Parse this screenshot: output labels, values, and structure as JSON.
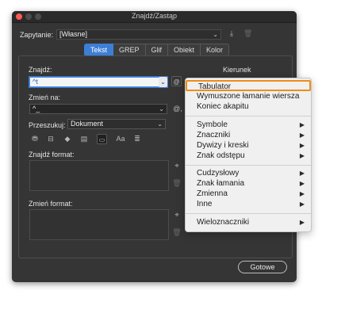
{
  "window": {
    "title": "Znajdź/Zastąp"
  },
  "query": {
    "label": "Zapytanie:",
    "value": "[Własne]"
  },
  "tabs": [
    {
      "label": "Tekst",
      "active": true
    },
    {
      "label": "GREP",
      "active": false
    },
    {
      "label": "Glif",
      "active": false
    },
    {
      "label": "Obiekt",
      "active": false
    },
    {
      "label": "Kolor",
      "active": false
    }
  ],
  "find": {
    "label": "Znajdź:",
    "value": "^t"
  },
  "direction": {
    "label": "Kierunek"
  },
  "replace": {
    "label": "Zmień na:",
    "value": "^_"
  },
  "search": {
    "label": "Przeszukuj:",
    "value": "Dokument"
  },
  "options_icons": [
    "lock-layers-icon",
    "lock-stories-icon",
    "hidden-layers-icon",
    "master-pages-icon",
    "footnotes-icon",
    "case-sensitive-icon",
    "whole-word-icon"
  ],
  "case_label": "Aa",
  "find_format": {
    "label": "Znajdź format:"
  },
  "change_format": {
    "label": "Zmień format:"
  },
  "done_button": "Gotowe",
  "special_menu": {
    "group1": [
      "Tabulator",
      "Wymuszone łamanie wiersza",
      "Koniec akapitu"
    ],
    "group2": [
      "Symbole",
      "Znaczniki",
      "Dywizy i kreski",
      "Znak odstępu"
    ],
    "group3": [
      "Cudzysłowy",
      "Znak łamania",
      "Zmienna",
      "Inne"
    ],
    "group4": [
      "Wieloznaczniki"
    ],
    "highlighted": "Tabulator",
    "accent": "#f08c18"
  },
  "colors": {
    "window_bg": "#353535",
    "tab_active": "#3d7fd6",
    "close_light": "#fc5b57"
  }
}
